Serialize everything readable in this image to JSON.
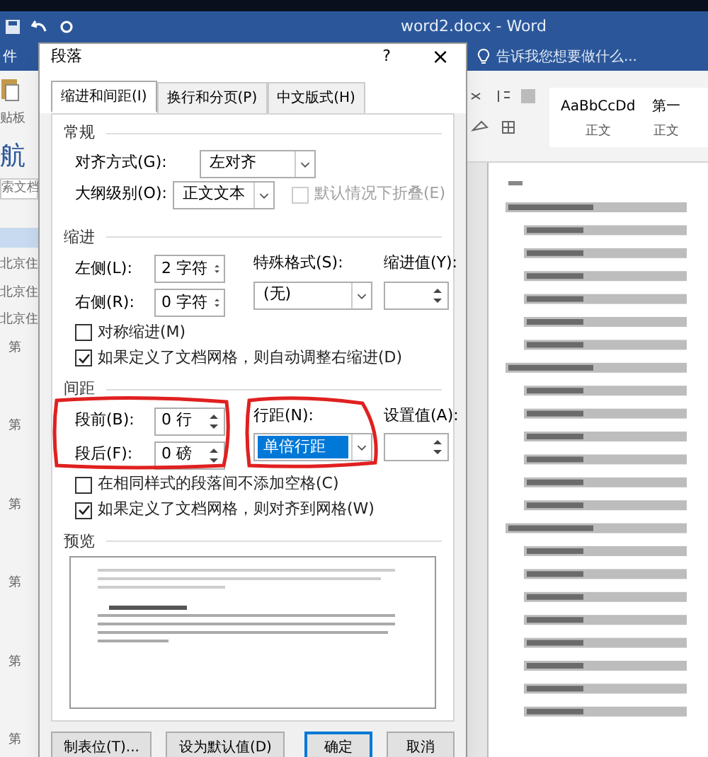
{
  "app": {
    "title": "word2.docx - Word",
    "file_tab": "件",
    "tell_me": "告诉我您想要做什么...",
    "styles": [
      {
        "preview": "AaBbCcDd",
        "name": "正文"
      },
      {
        "preview": "第一",
        "name": "正文"
      }
    ]
  },
  "nav_pane": {
    "clipboard": "贴板",
    "title": "航",
    "search": "索文档",
    "items": [
      "北京住",
      "北京住",
      "北京住"
    ],
    "headings": [
      "第",
      "第",
      "第",
      "第",
      "第",
      "第"
    ]
  },
  "dialog": {
    "title": "段落",
    "help": "?",
    "close": "×",
    "tabs": [
      {
        "label": "缩进和间距(I)",
        "selected": true
      },
      {
        "label": "换行和分页(P)",
        "selected": false
      },
      {
        "label": "中文版式(H)",
        "selected": false
      }
    ],
    "general": {
      "title": "常规",
      "alignment_label": "对齐方式(G):",
      "alignment": "左对齐",
      "outline_label": "大纲级别(O):",
      "outline": "正文文本",
      "collapse": {
        "label": "默认情况下折叠(E)",
        "checked": false,
        "disabled": true
      }
    },
    "indent": {
      "title": "缩进",
      "left_label": "左侧(L):",
      "left": "2 字符",
      "right_label": "右侧(R):",
      "right": "0 字符",
      "special_label": "特殊格式(S):",
      "special": "(无)",
      "by_label": "缩进值(Y):",
      "checks": [
        {
          "label": "对称缩进(M)",
          "checked": false
        },
        {
          "label": "如果定义了文档网格，则自动调整右缩进(D)",
          "checked": true
        }
      ]
    },
    "spacing": {
      "title": "间距",
      "before_label": "段前(B):",
      "before": "0 行",
      "after_label": "段后(F):",
      "after": "0 磅",
      "line_label": "行距(N):",
      "line": "单倍行距",
      "at_label": "设置值(A):",
      "checks": [
        {
          "label": "在相同样式的段落间不添加空格(C)",
          "checked": false
        },
        {
          "label": "如果定义了文档网格，则对齐到网格(W)",
          "checked": true
        }
      ]
    },
    "preview_title": "预览",
    "buttons": [
      {
        "label": "制表位(T)...",
        "primary": false
      },
      {
        "label": "设为默认值(D)",
        "primary": false
      },
      {
        "label": "确定",
        "primary": true
      },
      {
        "label": "取消",
        "primary": false
      }
    ]
  }
}
